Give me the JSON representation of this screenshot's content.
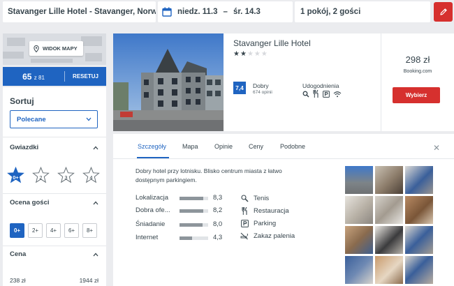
{
  "search": {
    "destination": "Stavanger Lille Hotel - Stavanger, Norwe",
    "checkin": "niedz. 11.3",
    "date_separator": "–",
    "checkout": "śr. 14.3",
    "rooms_guests": "1 pokój, 2 gości",
    "edit_icon": "pencil-icon"
  },
  "sidebar": {
    "map_label": "WIDOK MAPY",
    "results_count": "65",
    "results_total": "z 81",
    "reset_label": "RESETUJ",
    "sort_title": "Sortuj",
    "sort_value": "Polecane",
    "stars_title": "Gwiazdki",
    "star_options": [
      "0+",
      "2",
      "3",
      "4"
    ],
    "rating_title": "Ocena gości",
    "rating_options": [
      "0+",
      "2+",
      "4+",
      "6+",
      "8+"
    ],
    "price_title": "Cena",
    "price_min": "238 zł",
    "price_max": "1944 zł"
  },
  "hotel": {
    "name": "Stavanger Lille Hotel",
    "stars": 2,
    "stars_max": 5,
    "score": "7,4",
    "score_label": "Dobry",
    "reviews": "674 opinii",
    "amenities_title": "Udogodnienia",
    "amenity_icons": [
      "search-icon",
      "restaurant-icon",
      "parking-icon",
      "wifi-icon"
    ],
    "price": "298 zł",
    "provider": "Booking.com",
    "cta_label": "Wybierz"
  },
  "details": {
    "tabs": [
      "Szczegóły",
      "Mapa",
      "Opinie",
      "Ceny",
      "Podobne"
    ],
    "active_tab": "Szczegóły",
    "description": "Dobry hotel przy lotnisku. Blisko centrum miasta z łatwo dostępnym parkingiem.",
    "ratings": [
      {
        "label": "Lokalizacja",
        "value": "8,3",
        "score": 8.3
      },
      {
        "label": "Dobra ofe...",
        "value": "8,2",
        "score": 8.2
      },
      {
        "label": "Śniadanie",
        "value": "8,0",
        "score": 8.0
      },
      {
        "label": "Internet",
        "value": "4,3",
        "score": 4.3
      }
    ],
    "facilities": [
      {
        "label": "Tenis",
        "icon": "tennis-icon"
      },
      {
        "label": "Restauracja",
        "icon": "restaurant-icon"
      },
      {
        "label": "Parking",
        "icon": "parking-icon"
      },
      {
        "label": "Zakaz palenia",
        "icon": "no-smoking-icon"
      }
    ],
    "gallery_count": 12
  },
  "colors": {
    "accent_blue": "#1f64c1",
    "cta_red": "#d6302e",
    "page_bg": "#ebecef",
    "text": "#37454d"
  }
}
